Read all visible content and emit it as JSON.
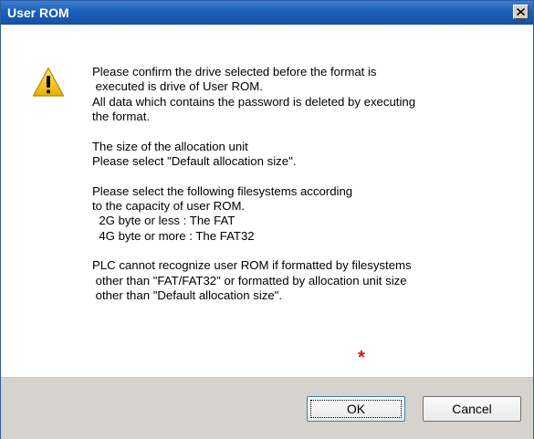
{
  "window": {
    "title": "User ROM",
    "close_symbol": "×"
  },
  "message": {
    "lines": [
      "Please confirm the drive selected before the format is",
      " executed is drive of User ROM.",
      "All data which contains the password is deleted by executing",
      "the format.",
      "",
      "The size of the allocation unit",
      "Please select \"Default allocation size\".",
      "",
      "Please select the following filesystems according",
      "to the capacity of user ROM.",
      "  2G byte or less : The FAT",
      "  4G byte or more : The FAT32",
      "",
      "PLC cannot recognize user ROM if formatted by filesystems",
      " other than \"FAT/FAT32\" or formatted by allocation unit size",
      " other than \"Default allocation size\"."
    ],
    "annotation": "*"
  },
  "buttons": {
    "ok_label": "OK",
    "cancel_label": "Cancel"
  },
  "icons": {
    "warning": "warning-triangle-icon",
    "close": "close-icon"
  },
  "colors": {
    "titlebar": "#1c5fb8",
    "footer": "#d6d3ce",
    "warning_fill": "#f2c21a",
    "annotation": "#e01010"
  }
}
